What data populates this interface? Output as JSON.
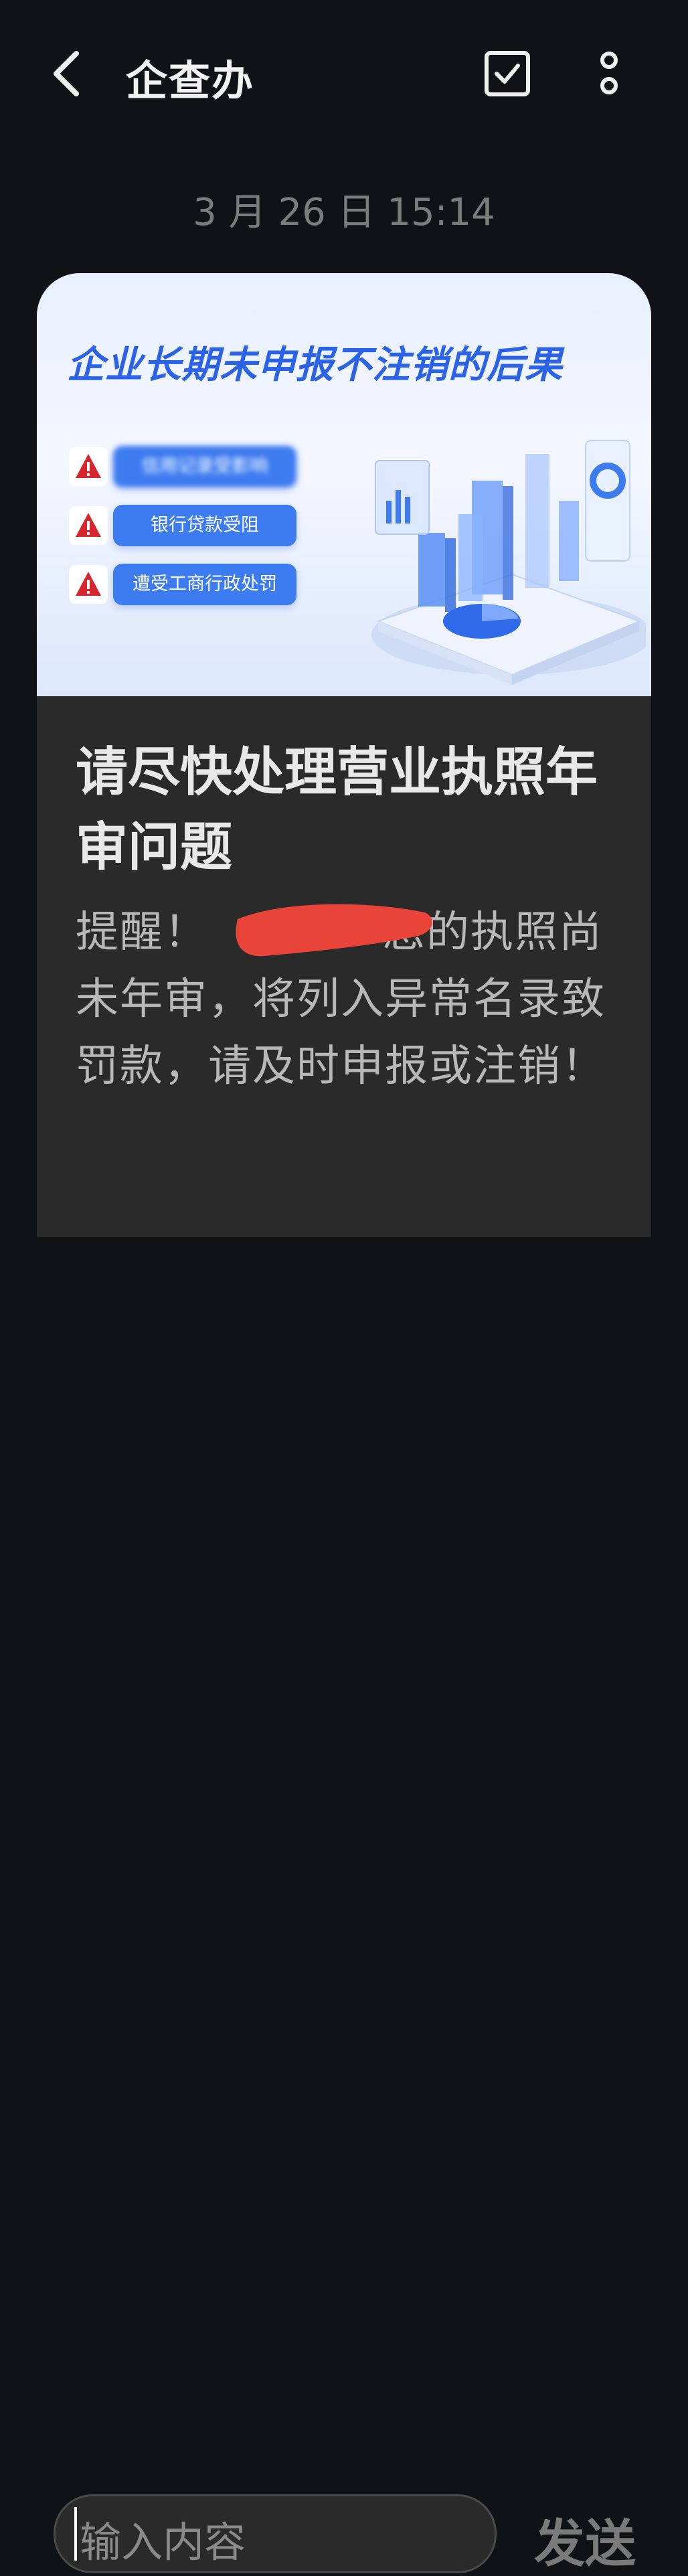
{
  "header": {
    "title": "企查办",
    "back_icon": "chevron-left-icon",
    "select_icon": "checkbox-icon",
    "more_icon": "more-vertical-icon"
  },
  "timestamp": "3 月 26 日 15:14",
  "card": {
    "banner_title": "企业长期未申报不注销的后果",
    "risks": [
      {
        "label": "信用记录受影响"
      },
      {
        "label": "银行贷款受阻"
      },
      {
        "label": "遭受工商行政处罚"
      }
    ],
    "message_title": "请尽快处理营业执照年审问题",
    "message_body_prefix": "提醒！",
    "message_body": "您的执照尚未年审，将列入异常名录致罚款，请及时申报或注销！"
  },
  "composer": {
    "placeholder": "输入内容",
    "send_label": "发送"
  },
  "colors": {
    "background": "#111215",
    "card": "#2a2a2b",
    "banner_accent": "#2a62e8",
    "pill": "#3d7bf0",
    "warning": "#d8262c",
    "redaction": "#e8443a"
  }
}
